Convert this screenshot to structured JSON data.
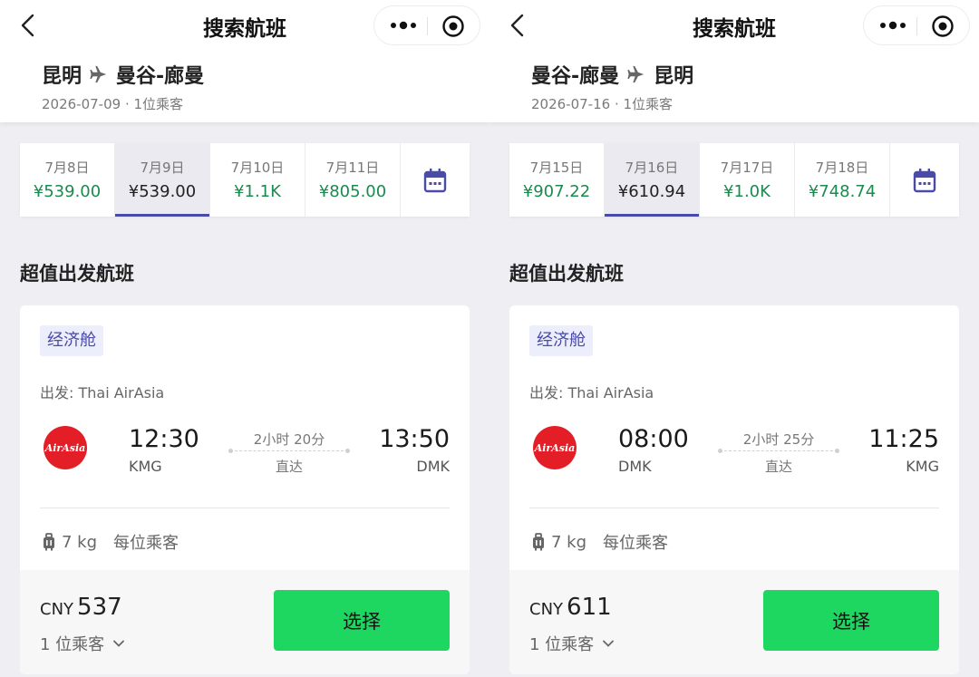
{
  "colors": {
    "price_green": "#1a8a4e",
    "select_green": "#1ed760",
    "accent_purple": "#4a4aa8",
    "airasia_red": "#e31e26"
  },
  "panels": [
    {
      "title": "搜索航班",
      "route": {
        "from": "昆明",
        "to": "曼谷-廊曼"
      },
      "date_line": "2026-07-09 · 1位乘客",
      "dates": [
        {
          "label": "7月8日",
          "price": "¥539.00",
          "selected": false
        },
        {
          "label": "7月9日",
          "price": "¥539.00",
          "selected": true
        },
        {
          "label": "7月10日",
          "price": "¥1.1K",
          "selected": false
        },
        {
          "label": "7月11日",
          "price": "¥805.00",
          "selected": false
        }
      ],
      "section_title": "超值出发航班",
      "flight": {
        "cabin": "经济舱",
        "airline": "出发: Thai AirAsia",
        "logo_text": "AirAsia",
        "dep_time": "12:30",
        "dep_code": "KMG",
        "duration": "2小时 20分",
        "stops": "直达",
        "arr_time": "13:50",
        "arr_code": "DMK",
        "baggage": "7 kg",
        "baggage_note": "每位乘客",
        "currency": "CNY",
        "amount": "537",
        "passengers": "1 位乘客",
        "select_label": "选择"
      }
    },
    {
      "title": "搜索航班",
      "route": {
        "from": "曼谷-廊曼",
        "to": "昆明"
      },
      "date_line": "2026-07-16 · 1位乘客",
      "dates": [
        {
          "label": "7月15日",
          "price": "¥907.22",
          "selected": false
        },
        {
          "label": "7月16日",
          "price": "¥610.94",
          "selected": true
        },
        {
          "label": "7月17日",
          "price": "¥1.0K",
          "selected": false
        },
        {
          "label": "7月18日",
          "price": "¥748.74",
          "selected": false
        }
      ],
      "section_title": "超值出发航班",
      "flight": {
        "cabin": "经济舱",
        "airline": "出发: Thai AirAsia",
        "logo_text": "AirAsia",
        "dep_time": "08:00",
        "dep_code": "DMK",
        "duration": "2小时 25分",
        "stops": "直达",
        "arr_time": "11:25",
        "arr_code": "KMG",
        "baggage": "7 kg",
        "baggage_note": "每位乘客",
        "currency": "CNY",
        "amount": "611",
        "passengers": "1 位乘客",
        "select_label": "选择"
      }
    }
  ]
}
